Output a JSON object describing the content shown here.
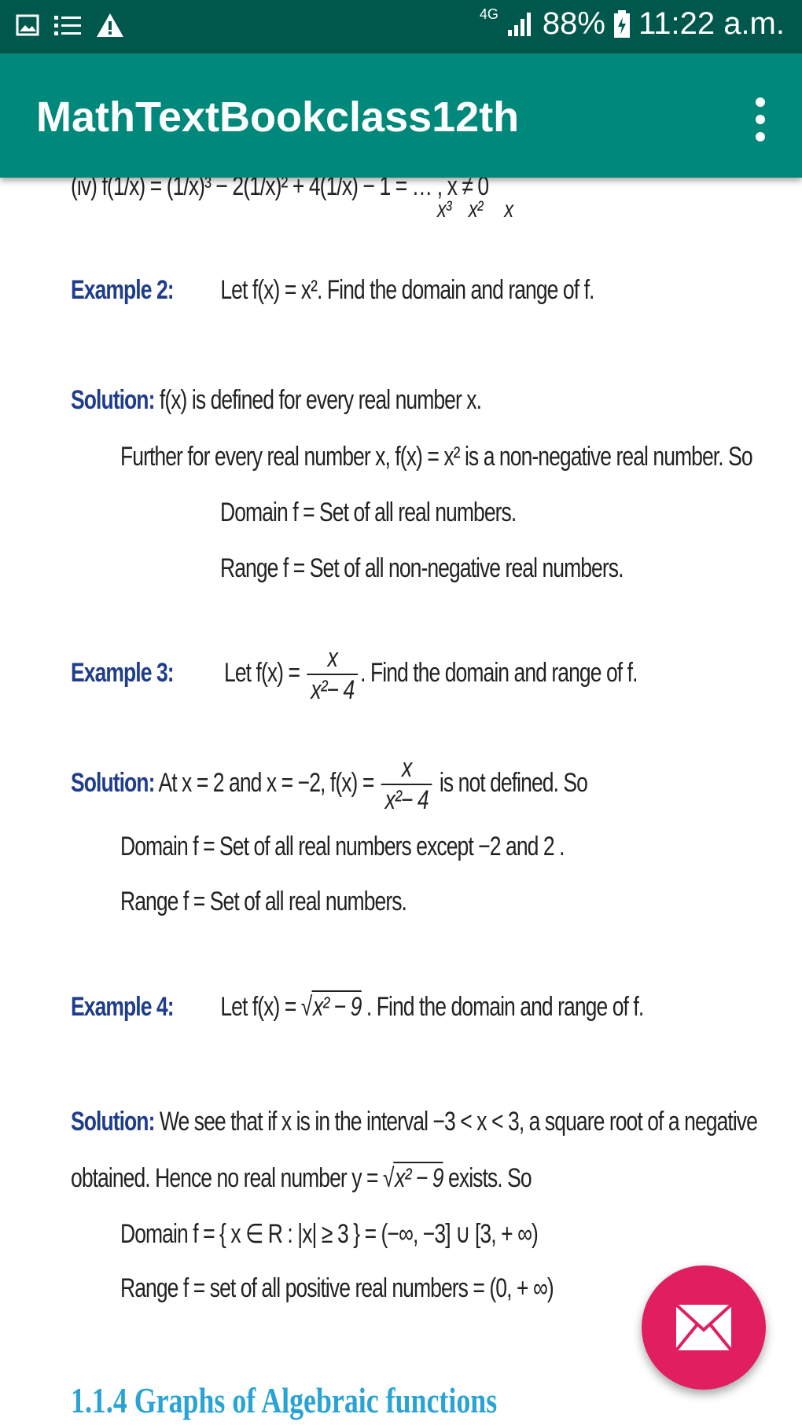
{
  "status_bar": {
    "network": "4G",
    "battery": "88%",
    "time": "11:22 a.m.",
    "icons": [
      "image-icon",
      "list-icon",
      "warning-icon",
      "signal-icon",
      "battery-icon"
    ]
  },
  "toolbar": {
    "title": "MathTextBookclass12th",
    "menu_icon": "more-vert-icon"
  },
  "content": {
    "partial_top": "(iv)   f(1/x) = (1/x)³ − 2(1/x)² + 4(1/x) − 1 = … , x ≠ 0",
    "partial_top_denoms": [
      "x³",
      "x²",
      "x"
    ],
    "example2": {
      "label": "Example 2:",
      "text": "Let f(x) = x². Find the domain and range of f."
    },
    "solution2": {
      "label": "Solution:",
      "line1": "f(x) is defined for every real number x.",
      "line2": "Further for every real number x, f(x) = x² is a non-negative real number. So",
      "line3": "Domain f = Set of all real numbers.",
      "line4": "Range f = Set of all non-negative real numbers."
    },
    "example3": {
      "label": "Example 3:",
      "prefix": "Let f(x) =",
      "num": "x",
      "den": "x²− 4",
      "suffix": ". Find the domain and range of f."
    },
    "solution3": {
      "label": "Solution:",
      "prefix": "At x = 2 and x = −2, f(x) =",
      "num": "x",
      "den": "x²− 4",
      "suffix": "is not defined. So",
      "line2": "Domain f = Set of all real numbers except −2 and 2 .",
      "line3": "Range f = Set of all real numbers."
    },
    "example4": {
      "label": "Example 4:",
      "prefix": "Let f(x) = √",
      "radicand": "x² − 9",
      "suffix": ". Find the domain and range of f."
    },
    "solution4": {
      "label": "Solution:",
      "line1": "We see that if x is in the interval −3 < x < 3, a square root of a negative",
      "line2_prefix": "obtained. Hence no real number y = √",
      "line2_radicand": "x² − 9",
      "line2_suffix": "exists. So",
      "line3": "Domain f = { x ∈ R : |x| ≥ 3 } = (−∞,  −3] ∪ [3, + ∞)",
      "line4": "Range f = set of all positive real numbers = (0, + ∞)"
    },
    "section_heading": "1.1.4     Graphs of Algebraic functions"
  },
  "fab": {
    "icon": "mail-icon"
  },
  "colors": {
    "status_bar": "#00574b",
    "toolbar": "#00897b",
    "label_blue": "#1f3d8a",
    "section_blue": "#29a3d6",
    "fab": "#e01e60"
  }
}
